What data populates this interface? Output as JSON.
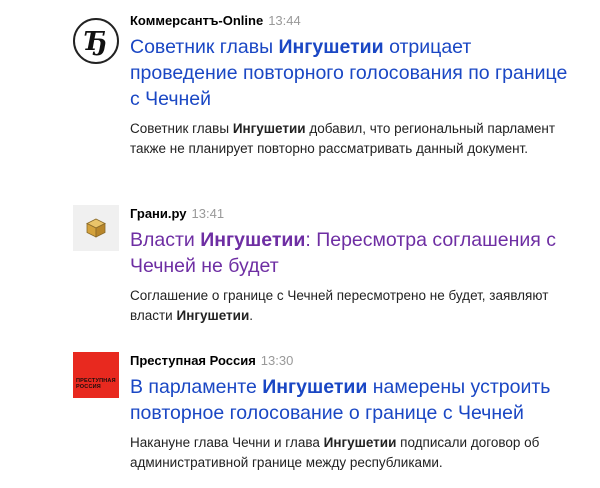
{
  "items": [
    {
      "source": "Коммерсантъ-Online",
      "time": "13:44",
      "logo_icon": "kommersant-logo-icon",
      "title_pre": "Советник главы ",
      "title_bold": "Ингушетии",
      "title_post": " отрицает проведение повторного голосования по границе с Чечней",
      "snippet_pre": "Советник главы ",
      "snippet_bold": "Ингушетии",
      "snippet_post": " добавил, что региональный парламент также не планирует повторно рассматривать данный документ.",
      "link_color": "#1a47c4"
    },
    {
      "source": "Грани.ру",
      "time": "13:41",
      "logo_icon": "grani-cube-icon",
      "title_pre": "Власти ",
      "title_bold": "Ингушетии",
      "title_post": ": Пересмотра соглашения с Чечней не будет",
      "snippet_pre": "Соглашение о границе с Чечней пересмотрено не будет, заявляют власти ",
      "snippet_bold": "Ингушетии",
      "snippet_post": ".",
      "link_color": "#6e2ea3"
    },
    {
      "source": "Преступная Россия",
      "time": "13:30",
      "logo_icon": "prestupnaya-rossiya-logo-icon",
      "logo_text_1": "ПРЕСТУПНАЯ",
      "logo_text_2": "РОССИЯ",
      "title_pre": "В парламенте ",
      "title_bold": "Ингушетии",
      "title_post": " намерены устроить повторное голосование о границе с Чечней",
      "snippet_pre": "Накануне глава Чечни и глава ",
      "snippet_bold": "Ингушетии",
      "snippet_post": " подписали договор об административной границе между республиками.",
      "link_color": "#1a47c4"
    }
  ]
}
